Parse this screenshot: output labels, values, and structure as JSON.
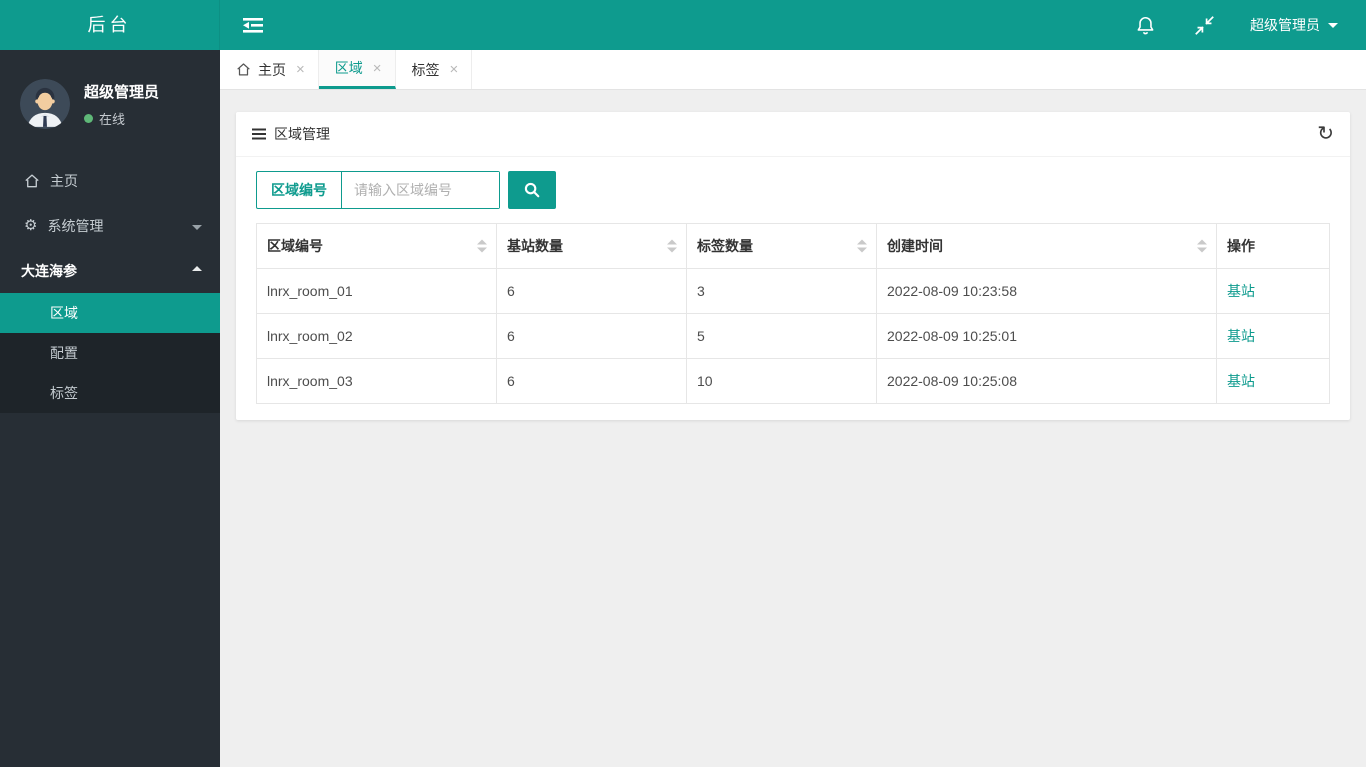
{
  "colors": {
    "accent": "#0e9b8e",
    "topbar_bg": "#0e9b8e",
    "sidebar_bg": "#272e35",
    "submenu_bg": "#1e2429",
    "online_dot": "#5fb878",
    "link": "#0e9b8e"
  },
  "icons": {
    "gear": "⚙",
    "refresh": "↻",
    "close": "×"
  },
  "topbar": {
    "brand": "后台",
    "user_label": "超级管理员"
  },
  "sidebar": {
    "profile": {
      "name": "超级管理员",
      "status": "在线"
    },
    "menu": {
      "home": "主页",
      "system": "系统管理",
      "project": "大连海参",
      "sub_area": "区域",
      "sub_config": "配置",
      "sub_tag": "标签"
    }
  },
  "tabs": {
    "home": "主页",
    "area": "区域",
    "tag": "标签"
  },
  "panel": {
    "title": "区域管理",
    "search": {
      "field_label": "区域编号",
      "placeholder": "请输入区域编号"
    }
  },
  "table": {
    "columns": [
      "区域编号",
      "基站数量",
      "标签数量",
      "创建时间",
      "操作"
    ],
    "rows": [
      {
        "area_id": "lnrx_room_01",
        "stations": "6",
        "tags": "3",
        "created": "2022-08-09 10:23:58",
        "action": "基站"
      },
      {
        "area_id": "lnrx_room_02",
        "stations": "6",
        "tags": "5",
        "created": "2022-08-09 10:25:01",
        "action": "基站"
      },
      {
        "area_id": "lnrx_room_03",
        "stations": "6",
        "tags": "10",
        "created": "2022-08-09 10:25:08",
        "action": "基站"
      }
    ]
  }
}
